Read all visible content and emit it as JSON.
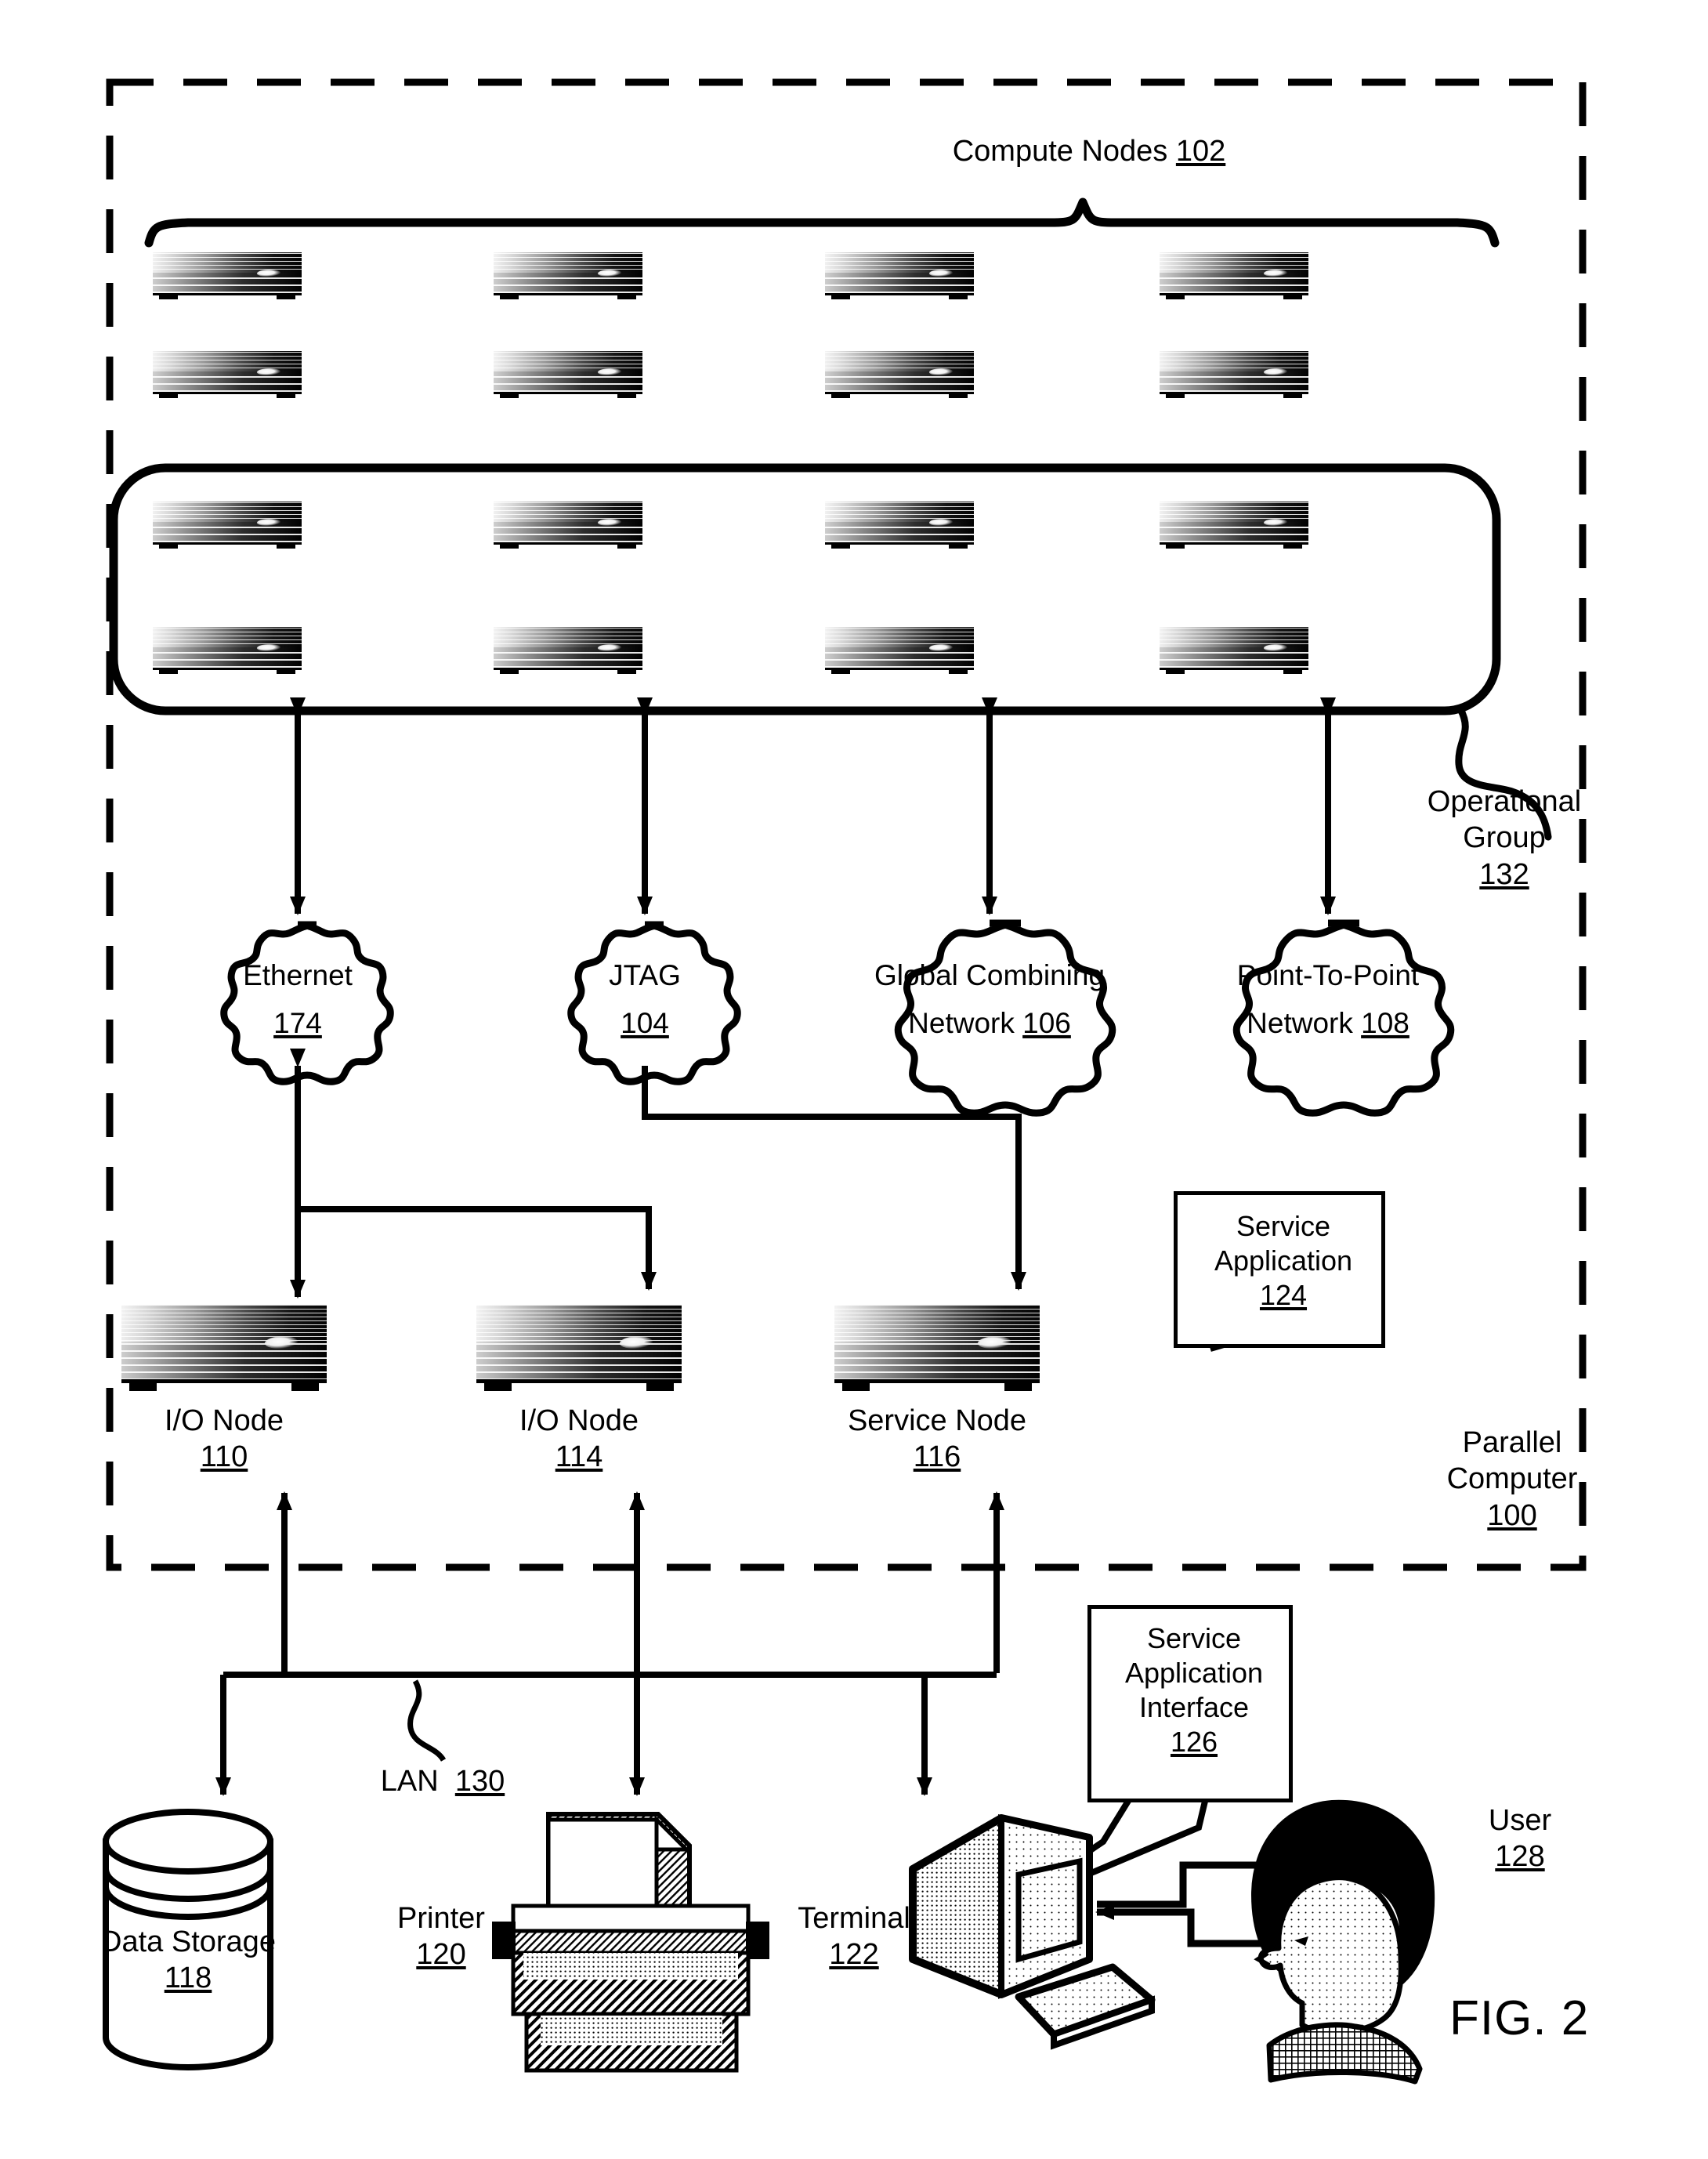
{
  "figure": {
    "caption": "FIG. 2"
  },
  "enclosure": {
    "label_line1": "Parallel",
    "label_line2": "Computer",
    "ref": "100"
  },
  "compute_nodes": {
    "label": "Compute Nodes",
    "ref": "102",
    "ungrouped_rows": 2,
    "ungrouped_columns": 4,
    "grouped_rows": 2,
    "grouped_columns": 4,
    "node_icon": "server-icon"
  },
  "operational_group": {
    "label_line1": "Operational",
    "label_line2": "Group",
    "ref": "132"
  },
  "networks": [
    {
      "name": "ethernet",
      "line1": "Ethernet",
      "line2": "",
      "ref": "174"
    },
    {
      "name": "jtag",
      "line1": "JTAG",
      "line2": "",
      "ref": "104"
    },
    {
      "name": "global-combining",
      "line1": "Global Combining",
      "line2": "Network",
      "ref": "106"
    },
    {
      "name": "point-to-point",
      "line1": "Point-To-Point",
      "line2": "Network",
      "ref": "108"
    }
  ],
  "nodes_row": [
    {
      "name": "io-node-110",
      "label": "I/O Node",
      "ref": "110"
    },
    {
      "name": "io-node-114",
      "label": "I/O Node",
      "ref": "114"
    },
    {
      "name": "service-node",
      "label": "Service Node",
      "ref": "116"
    }
  ],
  "service_application": {
    "line1": "Service",
    "line2": "Application",
    "ref": "124"
  },
  "service_application_interface": {
    "line1": "Service",
    "line2": "Application",
    "line3": "Interface",
    "ref": "126"
  },
  "lan": {
    "label": "LAN",
    "ref": "130"
  },
  "peripherals": [
    {
      "name": "data-storage",
      "label": "Data Storage",
      "ref": "118",
      "icon": "cylinder-icon"
    },
    {
      "name": "printer",
      "label": "Printer",
      "ref": "120",
      "icon": "printer-icon"
    },
    {
      "name": "terminal",
      "label": "Terminal",
      "ref": "122",
      "icon": "crt-terminal-icon"
    }
  ],
  "user": {
    "label": "User",
    "ref": "128",
    "icon": "person-head-icon"
  },
  "colors": {
    "ink": "#000000",
    "paper": "#ffffff"
  }
}
